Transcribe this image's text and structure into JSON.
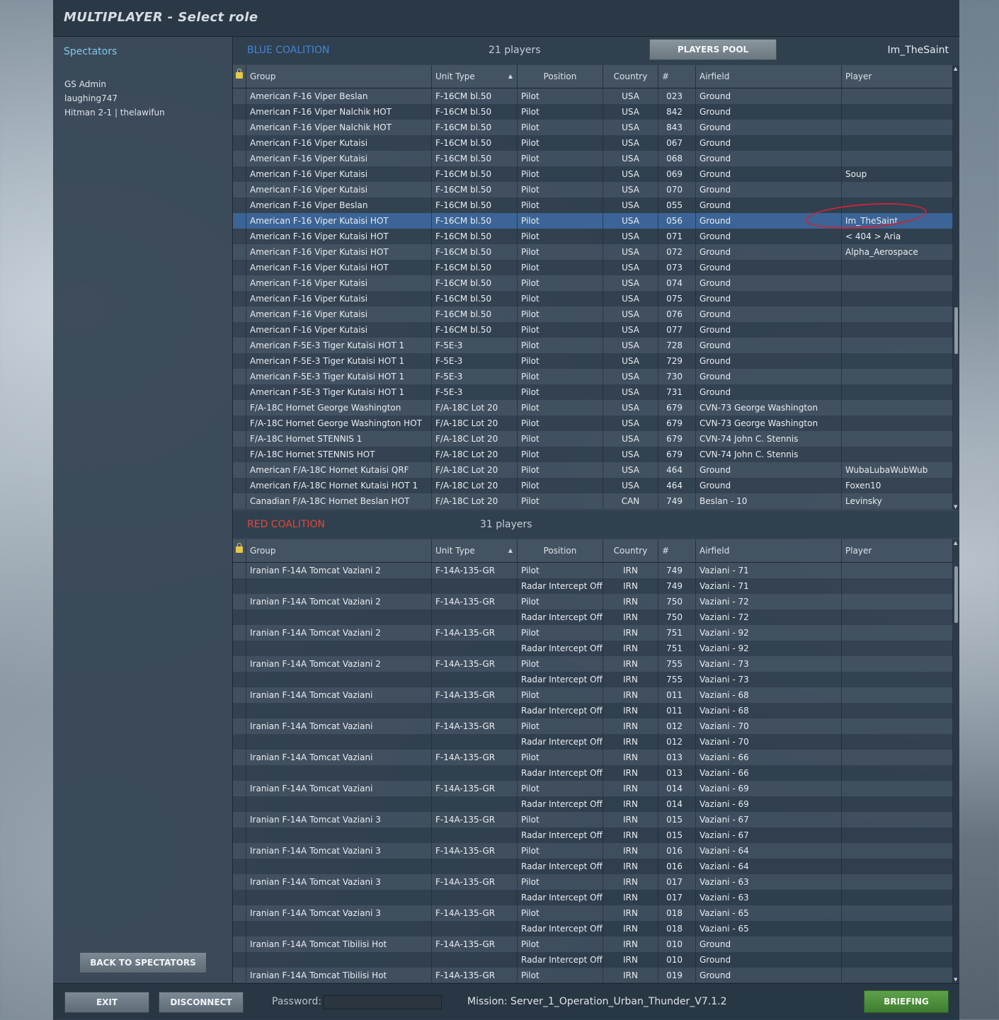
{
  "window": {
    "title": "MULTIPLAYER - Select role"
  },
  "spectators": {
    "title": "Spectators",
    "names": [
      "GS Admin",
      "laughing747",
      "Hitman 2-1 | thelawifun"
    ],
    "back_button": "BACK TO SPECTATORS"
  },
  "columns": {
    "group": "Group",
    "unit_type": "Unit Type",
    "position": "Position",
    "country": "Country",
    "number": "#",
    "airfield": "Airfield",
    "player": "Player"
  },
  "blue": {
    "name": "BLUE COALITION",
    "count": "21 players",
    "pool_button": "PLAYERS POOL",
    "current_player": "Im_TheSaint",
    "rows": [
      {
        "group": "American F-16 Viper Beslan",
        "unit": "F-16CM bl.50",
        "position": "Pilot",
        "country": "USA",
        "num": "023",
        "airfield": "Ground",
        "player": ""
      },
      {
        "group": "American F-16 Viper Nalchik HOT",
        "unit": "F-16CM bl.50",
        "position": "Pilot",
        "country": "USA",
        "num": "842",
        "airfield": "Ground",
        "player": ""
      },
      {
        "group": "American F-16 Viper Nalchik HOT",
        "unit": "F-16CM bl.50",
        "position": "Pilot",
        "country": "USA",
        "num": "843",
        "airfield": "Ground",
        "player": ""
      },
      {
        "group": "American F-16 Viper Kutaisi",
        "unit": "F-16CM bl.50",
        "position": "Pilot",
        "country": "USA",
        "num": "067",
        "airfield": "Ground",
        "player": ""
      },
      {
        "group": "American F-16 Viper Kutaisi",
        "unit": "F-16CM bl.50",
        "position": "Pilot",
        "country": "USA",
        "num": "068",
        "airfield": "Ground",
        "player": ""
      },
      {
        "group": "American F-16 Viper Kutaisi",
        "unit": "F-16CM bl.50",
        "position": "Pilot",
        "country": "USA",
        "num": "069",
        "airfield": "Ground",
        "player": "Soup"
      },
      {
        "group": "American F-16 Viper Kutaisi",
        "unit": "F-16CM bl.50",
        "position": "Pilot",
        "country": "USA",
        "num": "070",
        "airfield": "Ground",
        "player": ""
      },
      {
        "group": "American F-16 Viper Beslan",
        "unit": "F-16CM bl.50",
        "position": "Pilot",
        "country": "USA",
        "num": "055",
        "airfield": "Ground",
        "player": ""
      },
      {
        "group": "American F-16 Viper Kutaisi HOT",
        "unit": "F-16CM bl.50",
        "position": "Pilot",
        "country": "USA",
        "num": "056",
        "airfield": "Ground",
        "player": "Im_TheSaint",
        "selected": true
      },
      {
        "group": "American F-16 Viper Kutaisi HOT",
        "unit": "F-16CM bl.50",
        "position": "Pilot",
        "country": "USA",
        "num": "071",
        "airfield": "Ground",
        "player": "< 404 > Aria"
      },
      {
        "group": "American F-16 Viper Kutaisi HOT",
        "unit": "F-16CM bl.50",
        "position": "Pilot",
        "country": "USA",
        "num": "072",
        "airfield": "Ground",
        "player": "Alpha_Aerospace"
      },
      {
        "group": "American F-16 Viper Kutaisi HOT",
        "unit": "F-16CM bl.50",
        "position": "Pilot",
        "country": "USA",
        "num": "073",
        "airfield": "Ground",
        "player": ""
      },
      {
        "group": "American F-16 Viper Kutaisi",
        "unit": "F-16CM bl.50",
        "position": "Pilot",
        "country": "USA",
        "num": "074",
        "airfield": "Ground",
        "player": ""
      },
      {
        "group": "American F-16 Viper Kutaisi",
        "unit": "F-16CM bl.50",
        "position": "Pilot",
        "country": "USA",
        "num": "075",
        "airfield": "Ground",
        "player": ""
      },
      {
        "group": "American F-16 Viper Kutaisi",
        "unit": "F-16CM bl.50",
        "position": "Pilot",
        "country": "USA",
        "num": "076",
        "airfield": "Ground",
        "player": ""
      },
      {
        "group": "American F-16 Viper Kutaisi",
        "unit": "F-16CM bl.50",
        "position": "Pilot",
        "country": "USA",
        "num": "077",
        "airfield": "Ground",
        "player": ""
      },
      {
        "group": "American F-5E-3 Tiger Kutaisi HOT 1",
        "unit": "F-5E-3",
        "position": "Pilot",
        "country": "USA",
        "num": "728",
        "airfield": "Ground",
        "player": ""
      },
      {
        "group": "American F-5E-3 Tiger Kutaisi HOT 1",
        "unit": "F-5E-3",
        "position": "Pilot",
        "country": "USA",
        "num": "729",
        "airfield": "Ground",
        "player": ""
      },
      {
        "group": "American F-5E-3 Tiger Kutaisi HOT 1",
        "unit": "F-5E-3",
        "position": "Pilot",
        "country": "USA",
        "num": "730",
        "airfield": "Ground",
        "player": ""
      },
      {
        "group": "American F-5E-3 Tiger Kutaisi HOT 1",
        "unit": "F-5E-3",
        "position": "Pilot",
        "country": "USA",
        "num": "731",
        "airfield": "Ground",
        "player": ""
      },
      {
        "group": "F/A-18C Hornet George Washington",
        "unit": "F/A-18C Lot 20",
        "position": "Pilot",
        "country": "USA",
        "num": "679",
        "airfield": "CVN-73 George Washington",
        "player": ""
      },
      {
        "group": "F/A-18C Hornet George Washington HOT",
        "unit": "F/A-18C Lot 20",
        "position": "Pilot",
        "country": "USA",
        "num": "679",
        "airfield": "CVN-73 George Washington",
        "player": ""
      },
      {
        "group": "F/A-18C Hornet STENNIS 1",
        "unit": "F/A-18C Lot 20",
        "position": "Pilot",
        "country": "USA",
        "num": "679",
        "airfield": "CVN-74 John C. Stennis",
        "player": ""
      },
      {
        "group": "F/A-18C Hornet STENNIS HOT",
        "unit": "F/A-18C Lot 20",
        "position": "Pilot",
        "country": "USA",
        "num": "679",
        "airfield": "CVN-74 John C. Stennis",
        "player": ""
      },
      {
        "group": "American F/A-18C Hornet Kutaisi QRF",
        "unit": "F/A-18C Lot 20",
        "position": "Pilot",
        "country": "USA",
        "num": "464",
        "airfield": "Ground",
        "player": "WubaLubaWubWub"
      },
      {
        "group": "American F/A-18C Hornet Kutaisi HOT 1",
        "unit": "F/A-18C Lot 20",
        "position": "Pilot",
        "country": "USA",
        "num": "464",
        "airfield": "Ground",
        "player": "Foxen10"
      },
      {
        "group": "Canadian F/A-18C Hornet Beslan HOT",
        "unit": "F/A-18C Lot 20",
        "position": "Pilot",
        "country": "CAN",
        "num": "749",
        "airfield": "Beslan - 10",
        "player": "Levinsky"
      }
    ]
  },
  "red": {
    "name": "RED COALITION",
    "count": "31 players",
    "rows": [
      {
        "group": "Iranian F-14A Tomcat Vaziani 2",
        "unit": "F-14A-135-GR",
        "position": "Pilot",
        "country": "IRN",
        "num": "749",
        "airfield": "Vaziani - 71",
        "player": ""
      },
      {
        "group": "",
        "unit": "",
        "position": "Radar Intercept Officer",
        "country": "IRN",
        "num": "749",
        "airfield": "Vaziani - 71",
        "player": ""
      },
      {
        "group": "Iranian F-14A Tomcat Vaziani 2",
        "unit": "F-14A-135-GR",
        "position": "Pilot",
        "country": "IRN",
        "num": "750",
        "airfield": "Vaziani - 72",
        "player": ""
      },
      {
        "group": "",
        "unit": "",
        "position": "Radar Intercept Officer",
        "country": "IRN",
        "num": "750",
        "airfield": "Vaziani - 72",
        "player": ""
      },
      {
        "group": "Iranian F-14A Tomcat Vaziani 2",
        "unit": "F-14A-135-GR",
        "position": "Pilot",
        "country": "IRN",
        "num": "751",
        "airfield": "Vaziani - 92",
        "player": ""
      },
      {
        "group": "",
        "unit": "",
        "position": "Radar Intercept Officer",
        "country": "IRN",
        "num": "751",
        "airfield": "Vaziani - 92",
        "player": ""
      },
      {
        "group": "Iranian F-14A Tomcat Vaziani 2",
        "unit": "F-14A-135-GR",
        "position": "Pilot",
        "country": "IRN",
        "num": "755",
        "airfield": "Vaziani - 73",
        "player": ""
      },
      {
        "group": "",
        "unit": "",
        "position": "Radar Intercept Officer",
        "country": "IRN",
        "num": "755",
        "airfield": "Vaziani - 73",
        "player": ""
      },
      {
        "group": "Iranian F-14A Tomcat Vaziani",
        "unit": "F-14A-135-GR",
        "position": "Pilot",
        "country": "IRN",
        "num": "011",
        "airfield": "Vaziani - 68",
        "player": ""
      },
      {
        "group": "",
        "unit": "",
        "position": "Radar Intercept Officer",
        "country": "IRN",
        "num": "011",
        "airfield": "Vaziani - 68",
        "player": ""
      },
      {
        "group": "Iranian F-14A Tomcat Vaziani",
        "unit": "F-14A-135-GR",
        "position": "Pilot",
        "country": "IRN",
        "num": "012",
        "airfield": "Vaziani - 70",
        "player": ""
      },
      {
        "group": "",
        "unit": "",
        "position": "Radar Intercept Officer",
        "country": "IRN",
        "num": "012",
        "airfield": "Vaziani - 70",
        "player": ""
      },
      {
        "group": "Iranian F-14A Tomcat Vaziani",
        "unit": "F-14A-135-GR",
        "position": "Pilot",
        "country": "IRN",
        "num": "013",
        "airfield": "Vaziani - 66",
        "player": ""
      },
      {
        "group": "",
        "unit": "",
        "position": "Radar Intercept Officer",
        "country": "IRN",
        "num": "013",
        "airfield": "Vaziani - 66",
        "player": ""
      },
      {
        "group": "Iranian F-14A Tomcat Vaziani",
        "unit": "F-14A-135-GR",
        "position": "Pilot",
        "country": "IRN",
        "num": "014",
        "airfield": "Vaziani - 69",
        "player": ""
      },
      {
        "group": "",
        "unit": "",
        "position": "Radar Intercept Officer",
        "country": "IRN",
        "num": "014",
        "airfield": "Vaziani - 69",
        "player": ""
      },
      {
        "group": "Iranian F-14A Tomcat Vaziani 3",
        "unit": "F-14A-135-GR",
        "position": "Pilot",
        "country": "IRN",
        "num": "015",
        "airfield": "Vaziani - 67",
        "player": ""
      },
      {
        "group": "",
        "unit": "",
        "position": "Radar Intercept Officer",
        "country": "IRN",
        "num": "015",
        "airfield": "Vaziani - 67",
        "player": ""
      },
      {
        "group": "Iranian F-14A Tomcat Vaziani 3",
        "unit": "F-14A-135-GR",
        "position": "Pilot",
        "country": "IRN",
        "num": "016",
        "airfield": "Vaziani - 64",
        "player": ""
      },
      {
        "group": "",
        "unit": "",
        "position": "Radar Intercept Officer",
        "country": "IRN",
        "num": "016",
        "airfield": "Vaziani - 64",
        "player": ""
      },
      {
        "group": "Iranian F-14A Tomcat Vaziani 3",
        "unit": "F-14A-135-GR",
        "position": "Pilot",
        "country": "IRN",
        "num": "017",
        "airfield": "Vaziani - 63",
        "player": ""
      },
      {
        "group": "",
        "unit": "",
        "position": "Radar Intercept Officer",
        "country": "IRN",
        "num": "017",
        "airfield": "Vaziani - 63",
        "player": ""
      },
      {
        "group": "Iranian F-14A Tomcat Vaziani 3",
        "unit": "F-14A-135-GR",
        "position": "Pilot",
        "country": "IRN",
        "num": "018",
        "airfield": "Vaziani - 65",
        "player": ""
      },
      {
        "group": "",
        "unit": "",
        "position": "Radar Intercept Officer",
        "country": "IRN",
        "num": "018",
        "airfield": "Vaziani - 65",
        "player": ""
      },
      {
        "group": "Iranian F-14A Tomcat Tibilisi Hot",
        "unit": "F-14A-135-GR",
        "position": "Pilot",
        "country": "IRN",
        "num": "010",
        "airfield": "Ground",
        "player": ""
      },
      {
        "group": "",
        "unit": "",
        "position": "Radar Intercept Officer",
        "country": "IRN",
        "num": "010",
        "airfield": "Ground",
        "player": ""
      },
      {
        "group": "Iranian F-14A Tomcat Tibilisi Hot",
        "unit": "F-14A-135-GR",
        "position": "Pilot",
        "country": "IRN",
        "num": "019",
        "airfield": "Ground",
        "player": ""
      }
    ]
  },
  "bottom": {
    "exit": "EXIT",
    "disconnect": "DISCONNECT",
    "password_label": "Password:",
    "password_value": "",
    "mission": "Mission: Server_1_Operation_Urban_Thunder_V7.1.2",
    "briefing": "BRIEFING"
  },
  "colors": {
    "blue_coalition": "#3f86d8",
    "red_coalition": "#e0473a",
    "selected_row": "#3c6496",
    "briefing": "#4f8f3e"
  }
}
